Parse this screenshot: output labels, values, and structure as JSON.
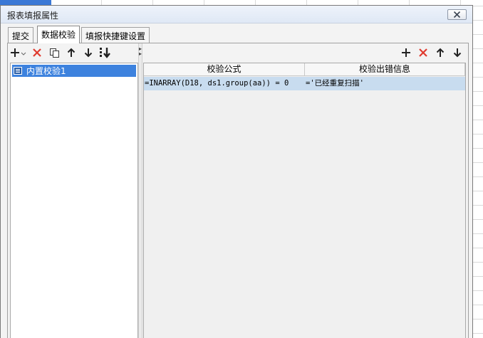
{
  "dialog": {
    "title": "报表填报属性"
  },
  "tabs": [
    {
      "label": "提交",
      "active": false
    },
    {
      "label": "数据校验",
      "active": true
    },
    {
      "label": "填报快捷键设置",
      "active": false
    }
  ],
  "left_toolbar": {
    "icons": [
      "add-dropdown-icon",
      "delete-icon",
      "copy-icon",
      "move-up-icon",
      "move-down-icon",
      "move-to-bottom-icon"
    ]
  },
  "tree": {
    "items": [
      {
        "label": "内置校验1",
        "selected": true
      }
    ]
  },
  "right_toolbar": {
    "icons": [
      "add-icon",
      "delete-icon",
      "move-up-icon",
      "move-down-icon"
    ]
  },
  "grid": {
    "columns": [
      "校验公式",
      "校验出错信息"
    ],
    "rows": [
      {
        "formula": "=INARRAY(D18, ds1.group(aa)) = 0",
        "message": "='已经重复扫描'"
      }
    ]
  },
  "colors": {
    "selection": "#3d82de",
    "row_highlight": "#c8dcef",
    "delete_red": "#e03a2e",
    "bg_accent_blue": "#3a78d6"
  }
}
